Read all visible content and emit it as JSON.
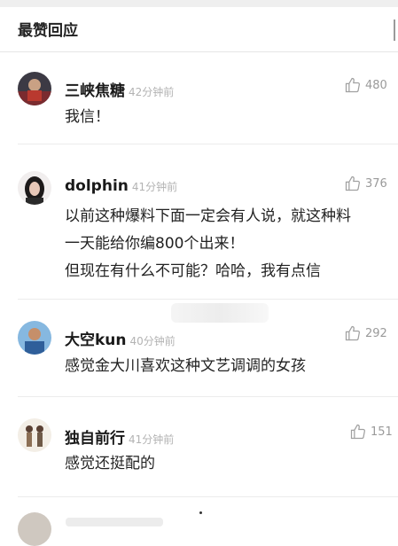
{
  "header": {
    "title": "最赞回应"
  },
  "comments": [
    {
      "name": "三峡焦糖",
      "time": "42分钟前",
      "likes": "480",
      "lines": [
        "我信！"
      ]
    },
    {
      "name": "dolphin",
      "time": "41分钟前",
      "likes": "376",
      "lines": [
        "以前这种爆料下面一定会有人说，就这种料",
        "一天能给你编800个出来！",
        "但现在有什么不可能？哈哈，我有点信"
      ]
    },
    {
      "name": "大空kun",
      "time": "40分钟前",
      "likes": "292",
      "lines": [
        "感觉金大川喜欢这种文艺调调的女孩"
      ]
    },
    {
      "name": "独自前行",
      "time": "41分钟前",
      "likes": "151",
      "lines": [
        "感觉还挺配的"
      ]
    }
  ],
  "icons": {
    "like": "thumbs-up-icon"
  },
  "colors": {
    "meta_gray": "#b3b3b3",
    "count_gray": "#9a9a9a",
    "text": "#222222"
  }
}
